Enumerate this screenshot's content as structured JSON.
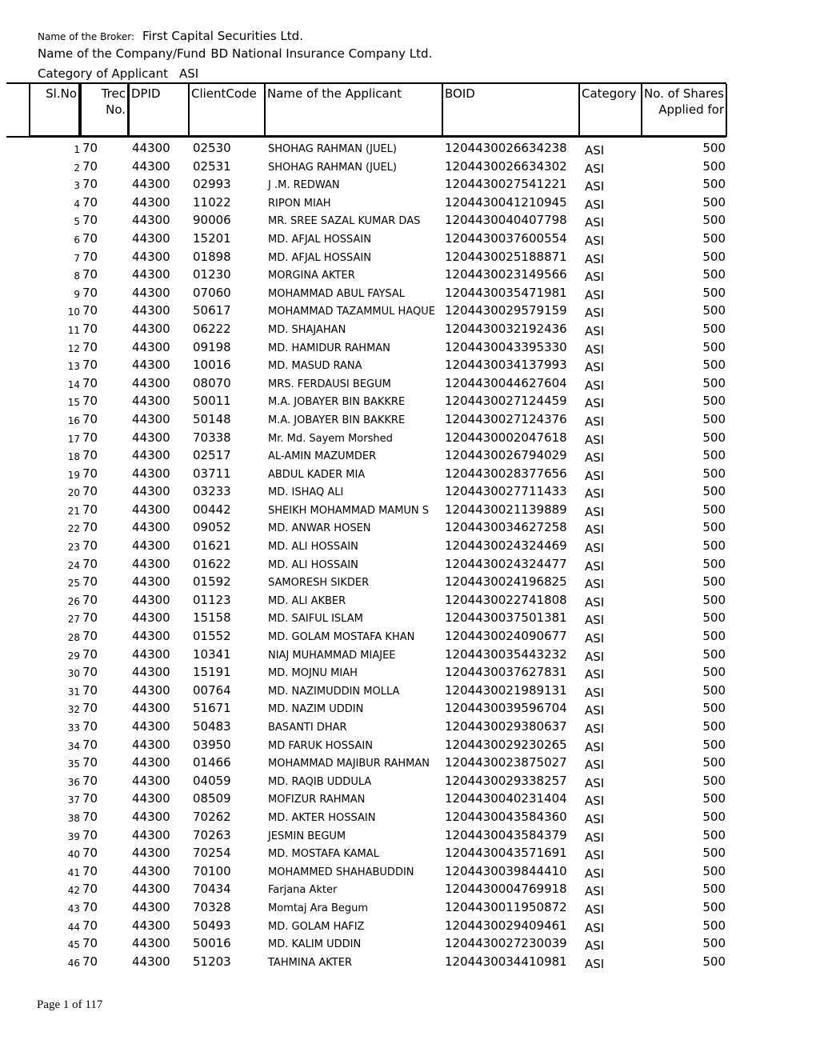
{
  "header": {
    "broker_label": "Name of the Broker:",
    "broker_value": "First Capital Securities Ltd.",
    "company_label": "Name of the Company/Fund",
    "company_value": "BD National Insurance Company Ltd.",
    "category_label": "Category of Applicant",
    "category_value": "ASI"
  },
  "table": {
    "columns": [
      "Sl.No",
      "Trec No.",
      "DPID",
      "ClientCode",
      "Name of the Applicant",
      "BOID",
      "Category",
      "No. of Shares Applied for"
    ],
    "col_labels": {
      "sl": "Sl.No",
      "trec_1": "Trec",
      "trec_2": "No.",
      "dpid": "DPID",
      "client": "ClientCode",
      "name": "Name of the Applicant",
      "boid": "BOID",
      "category": "Category",
      "shares_1": "No. of Shares",
      "shares_2": "Applied for"
    },
    "rows": [
      {
        "sl": "1",
        "trec": "70",
        "dpid": "44300",
        "client": "02530",
        "name": "SHOHAG RAHMAN (JUEL)",
        "boid": "1204430026634238",
        "category": "ASI",
        "shares": "500"
      },
      {
        "sl": "2",
        "trec": "70",
        "dpid": "44300",
        "client": "02531",
        "name": "SHOHAG RAHMAN (JUEL)",
        "boid": "1204430026634302",
        "category": "ASI",
        "shares": "500"
      },
      {
        "sl": "3",
        "trec": "70",
        "dpid": "44300",
        "client": "02993",
        "name": "J .M. REDWAN",
        "boid": "1204430027541221",
        "category": "ASI",
        "shares": "500"
      },
      {
        "sl": "4",
        "trec": "70",
        "dpid": "44300",
        "client": "11022",
        "name": "RIPON MIAH",
        "boid": "1204430041210945",
        "category": "ASI",
        "shares": "500"
      },
      {
        "sl": "5",
        "trec": "70",
        "dpid": "44300",
        "client": "90006",
        "name": "MR. SREE SAZAL KUMAR DAS",
        "boid": "1204430040407798",
        "category": "ASI",
        "shares": "500"
      },
      {
        "sl": "6",
        "trec": "70",
        "dpid": "44300",
        "client": "15201",
        "name": "MD. AFJAL HOSSAIN",
        "boid": "1204430037600554",
        "category": "ASI",
        "shares": "500"
      },
      {
        "sl": "7",
        "trec": "70",
        "dpid": "44300",
        "client": "01898",
        "name": "MD. AFJAL HOSSAIN",
        "boid": "1204430025188871",
        "category": "ASI",
        "shares": "500"
      },
      {
        "sl": "8",
        "trec": "70",
        "dpid": "44300",
        "client": "01230",
        "name": "MORGINA AKTER",
        "boid": "1204430023149566",
        "category": "ASI",
        "shares": "500"
      },
      {
        "sl": "9",
        "trec": "70",
        "dpid": "44300",
        "client": "07060",
        "name": "MOHAMMAD ABUL FAYSAL",
        "boid": "1204430035471981",
        "category": "ASI",
        "shares": "500"
      },
      {
        "sl": "10",
        "trec": "70",
        "dpid": "44300",
        "client": "50617",
        "name": "MOHAMMAD TAZAMMUL HAQUE",
        "boid": "1204430029579159",
        "category": "ASI",
        "shares": "500"
      },
      {
        "sl": "11",
        "trec": "70",
        "dpid": "44300",
        "client": "06222",
        "name": "MD. SHAJAHAN",
        "boid": "1204430032192436",
        "category": "ASI",
        "shares": "500"
      },
      {
        "sl": "12",
        "trec": "70",
        "dpid": "44300",
        "client": "09198",
        "name": "MD. HAMIDUR RAHMAN",
        "boid": "1204430043395330",
        "category": "ASI",
        "shares": "500"
      },
      {
        "sl": "13",
        "trec": "70",
        "dpid": "44300",
        "client": "10016",
        "name": "MD. MASUD RANA",
        "boid": "1204430034137993",
        "category": "ASI",
        "shares": "500"
      },
      {
        "sl": "14",
        "trec": "70",
        "dpid": "44300",
        "client": "08070",
        "name": "MRS. FERDAUSI BEGUM",
        "boid": "1204430044627604",
        "category": "ASI",
        "shares": "500"
      },
      {
        "sl": "15",
        "trec": "70",
        "dpid": "44300",
        "client": "50011",
        "name": "M.A. JOBAYER BIN BAKKRE",
        "boid": "1204430027124459",
        "category": "ASI",
        "shares": "500"
      },
      {
        "sl": "16",
        "trec": "70",
        "dpid": "44300",
        "client": "50148",
        "name": "M.A. JOBAYER BIN BAKKRE",
        "boid": "1204430027124376",
        "category": "ASI",
        "shares": "500"
      },
      {
        "sl": "17",
        "trec": "70",
        "dpid": "44300",
        "client": "70338",
        "name": "Mr. Md. Sayem Morshed",
        "boid": "1204430002047618",
        "category": "ASI",
        "shares": "500"
      },
      {
        "sl": "18",
        "trec": "70",
        "dpid": "44300",
        "client": "02517",
        "name": "AL-AMIN MAZUMDER",
        "boid": "1204430026794029",
        "category": "ASI",
        "shares": "500"
      },
      {
        "sl": "19",
        "trec": "70",
        "dpid": "44300",
        "client": "03711",
        "name": "ABDUL KADER MIA",
        "boid": "1204430028377656",
        "category": "ASI",
        "shares": "500"
      },
      {
        "sl": "20",
        "trec": "70",
        "dpid": "44300",
        "client": "03233",
        "name": "MD. ISHAQ ALI",
        "boid": "1204430027711433",
        "category": "ASI",
        "shares": "500"
      },
      {
        "sl": "21",
        "trec": "70",
        "dpid": "44300",
        "client": "00442",
        "name": "SHEIKH MOHAMMAD MAMUN S",
        "boid": "1204430021139889",
        "category": "ASI",
        "shares": "500"
      },
      {
        "sl": "22",
        "trec": "70",
        "dpid": "44300",
        "client": "09052",
        "name": "MD. ANWAR HOSEN",
        "boid": "1204430034627258",
        "category": "ASI",
        "shares": "500"
      },
      {
        "sl": "23",
        "trec": "70",
        "dpid": "44300",
        "client": "01621",
        "name": "MD. ALI HOSSAIN",
        "boid": "1204430024324469",
        "category": "ASI",
        "shares": "500"
      },
      {
        "sl": "24",
        "trec": "70",
        "dpid": "44300",
        "client": "01622",
        "name": "MD. ALI HOSSAIN",
        "boid": "1204430024324477",
        "category": "ASI",
        "shares": "500"
      },
      {
        "sl": "25",
        "trec": "70",
        "dpid": "44300",
        "client": "01592",
        "name": "SAMORESH SIKDER",
        "boid": "1204430024196825",
        "category": "ASI",
        "shares": "500"
      },
      {
        "sl": "26",
        "trec": "70",
        "dpid": "44300",
        "client": "01123",
        "name": "MD. ALI AKBER",
        "boid": "1204430022741808",
        "category": "ASI",
        "shares": "500"
      },
      {
        "sl": "27",
        "trec": "70",
        "dpid": "44300",
        "client": "15158",
        "name": "MD. SAIFUL ISLAM",
        "boid": "1204430037501381",
        "category": "ASI",
        "shares": "500"
      },
      {
        "sl": "28",
        "trec": "70",
        "dpid": "44300",
        "client": "01552",
        "name": "MD. GOLAM MOSTAFA KHAN",
        "boid": "1204430024090677",
        "category": "ASI",
        "shares": "500"
      },
      {
        "sl": "29",
        "trec": "70",
        "dpid": "44300",
        "client": "10341",
        "name": "NIAJ MUHAMMAD MIAJEE",
        "boid": "1204430035443232",
        "category": "ASI",
        "shares": "500"
      },
      {
        "sl": "30",
        "trec": "70",
        "dpid": "44300",
        "client": "15191",
        "name": "MD. MOJNU MIAH",
        "boid": "1204430037627831",
        "category": "ASI",
        "shares": "500"
      },
      {
        "sl": "31",
        "trec": "70",
        "dpid": "44300",
        "client": "00764",
        "name": "MD. NAZIMUDDIN MOLLA",
        "boid": "1204430021989131",
        "category": "ASI",
        "shares": "500"
      },
      {
        "sl": "32",
        "trec": "70",
        "dpid": "44300",
        "client": "51671",
        "name": "MD. NAZIM UDDIN",
        "boid": "1204430039596704",
        "category": "ASI",
        "shares": "500"
      },
      {
        "sl": "33",
        "trec": "70",
        "dpid": "44300",
        "client": "50483",
        "name": "BASANTI DHAR",
        "boid": "1204430029380637",
        "category": "ASI",
        "shares": "500"
      },
      {
        "sl": "34",
        "trec": "70",
        "dpid": "44300",
        "client": "03950",
        "name": "MD FARUK HOSSAIN",
        "boid": "1204430029230265",
        "category": "ASI",
        "shares": "500"
      },
      {
        "sl": "35",
        "trec": "70",
        "dpid": "44300",
        "client": "01466",
        "name": "MOHAMMAD MAJIBUR RAHMAN",
        "boid": "1204430023875027",
        "category": "ASI",
        "shares": "500"
      },
      {
        "sl": "36",
        "trec": "70",
        "dpid": "44300",
        "client": "04059",
        "name": "MD. RAQIB UDDULA",
        "boid": "1204430029338257",
        "category": "ASI",
        "shares": "500"
      },
      {
        "sl": "37",
        "trec": "70",
        "dpid": "44300",
        "client": "08509",
        "name": "MOFIZUR RAHMAN",
        "boid": "1204430040231404",
        "category": "ASI",
        "shares": "500"
      },
      {
        "sl": "38",
        "trec": "70",
        "dpid": "44300",
        "client": "70262",
        "name": "MD. AKTER HOSSAIN",
        "boid": "1204430043584360",
        "category": "ASI",
        "shares": "500"
      },
      {
        "sl": "39",
        "trec": "70",
        "dpid": "44300",
        "client": "70263",
        "name": "JESMIN BEGUM",
        "boid": "1204430043584379",
        "category": "ASI",
        "shares": "500"
      },
      {
        "sl": "40",
        "trec": "70",
        "dpid": "44300",
        "client": "70254",
        "name": "MD. MOSTAFA KAMAL",
        "boid": "1204430043571691",
        "category": "ASI",
        "shares": "500"
      },
      {
        "sl": "41",
        "trec": "70",
        "dpid": "44300",
        "client": "70100",
        "name": "MOHAMMED SHAHABUDDIN",
        "boid": "1204430039844410",
        "category": "ASI",
        "shares": "500"
      },
      {
        "sl": "42",
        "trec": "70",
        "dpid": "44300",
        "client": "70434",
        "name": "Farjana Akter",
        "boid": "1204430004769918",
        "category": "ASI",
        "shares": "500"
      },
      {
        "sl": "43",
        "trec": "70",
        "dpid": "44300",
        "client": "70328",
        "name": "Momtaj Ara Begum",
        "boid": "1204430011950872",
        "category": "ASI",
        "shares": "500"
      },
      {
        "sl": "44",
        "trec": "70",
        "dpid": "44300",
        "client": "50493",
        "name": "MD. GOLAM HAFIZ",
        "boid": "1204430029409461",
        "category": "ASI",
        "shares": "500"
      },
      {
        "sl": "45",
        "trec": "70",
        "dpid": "44300",
        "client": "50016",
        "name": "MD. KALIM UDDIN",
        "boid": "1204430027230039",
        "category": "ASI",
        "shares": "500"
      },
      {
        "sl": "46",
        "trec": "70",
        "dpid": "44300",
        "client": "51203",
        "name": "TAHMINA AKTER",
        "boid": "1204430034410981",
        "category": "ASI",
        "shares": "500"
      }
    ]
  },
  "footer": {
    "page_label": "Page 1 of 117"
  }
}
